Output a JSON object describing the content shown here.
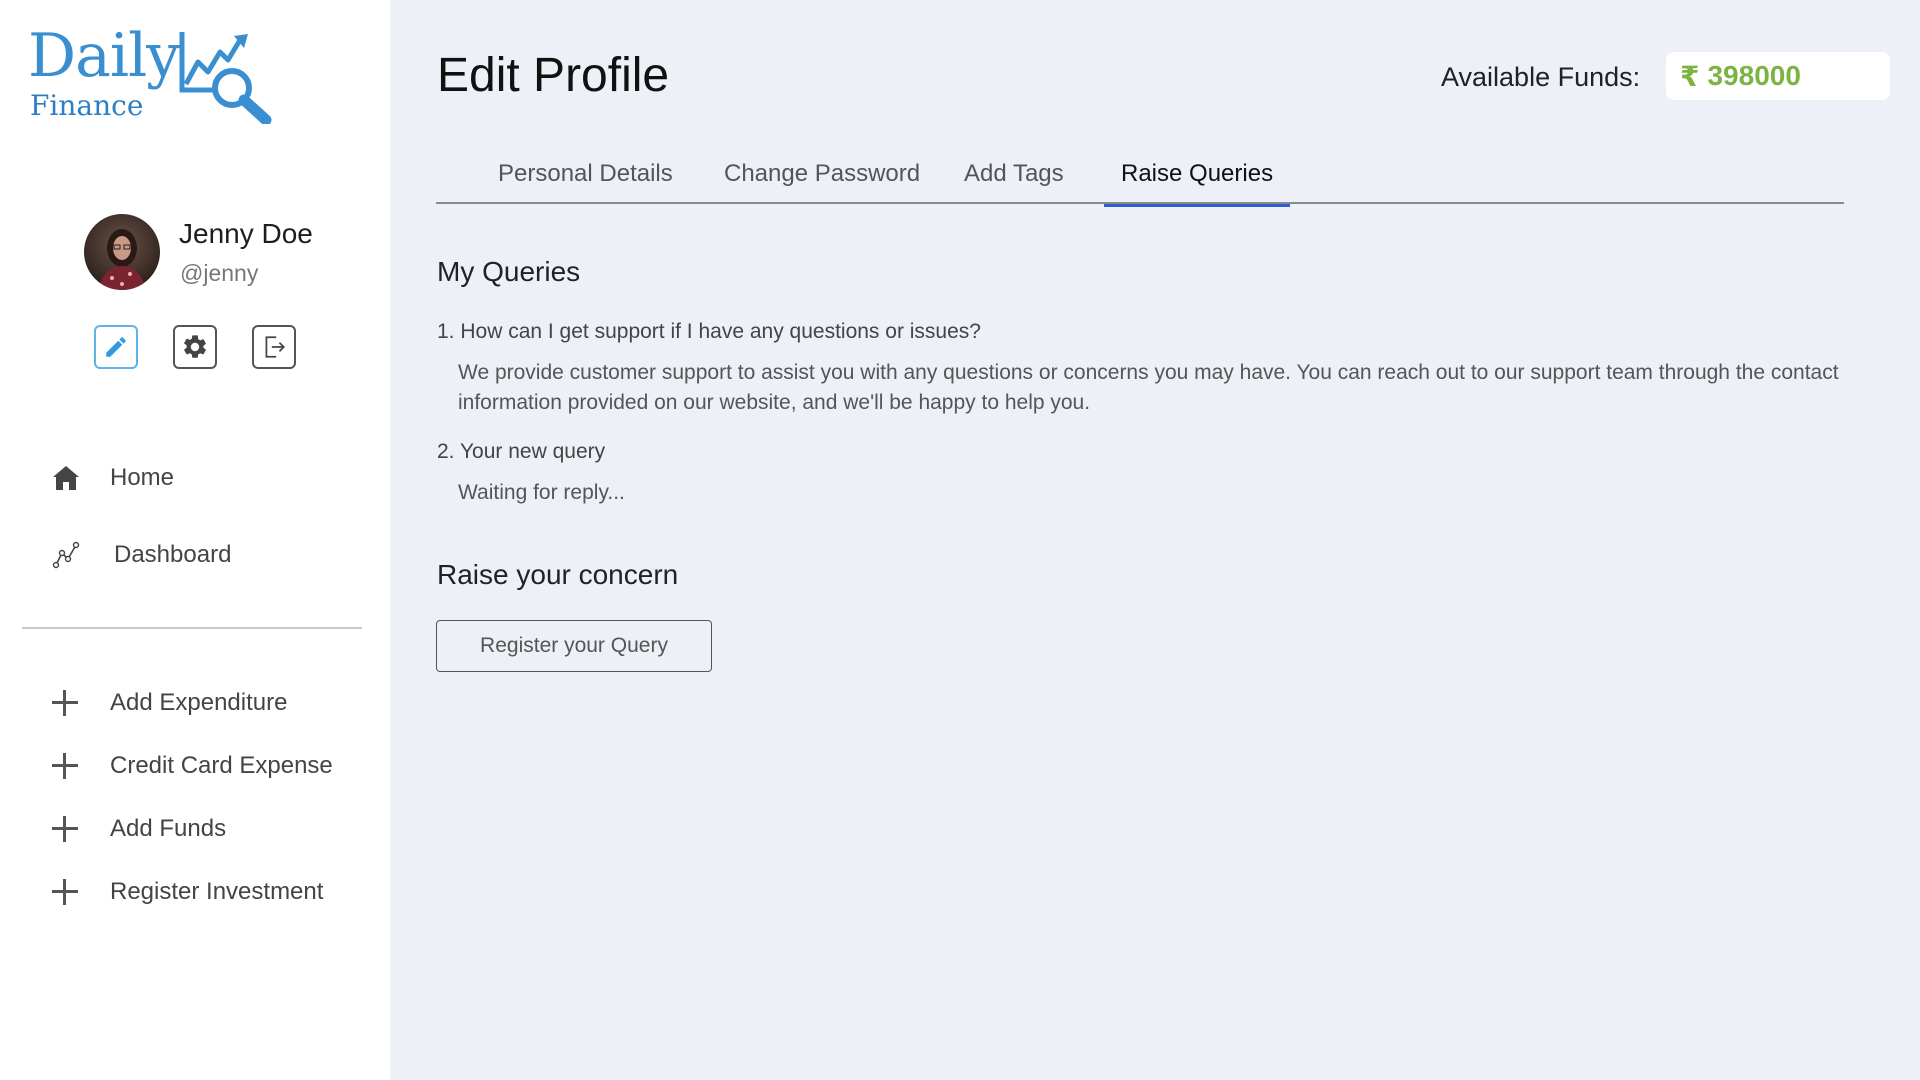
{
  "brand": {
    "name": "Daily",
    "sub": "Finance",
    "accent": "#3a8fd0"
  },
  "user": {
    "name": "Jenny Doe",
    "handle": "@jenny"
  },
  "profile_actions": [
    {
      "icon": "pencil-icon"
    },
    {
      "icon": "gear-icon"
    },
    {
      "icon": "logout-icon"
    }
  ],
  "nav": [
    {
      "label": "Home",
      "icon": "home-icon"
    },
    {
      "label": "Dashboard",
      "icon": "chart-icon"
    }
  ],
  "actions": [
    {
      "label": "Add Expenditure",
      "icon": "plus-icon"
    },
    {
      "label": "Credit Card Expense",
      "icon": "plus-icon"
    },
    {
      "label": "Add Funds",
      "icon": "plus-icon"
    },
    {
      "label": "Register Investment",
      "icon": "plus-icon"
    }
  ],
  "header": {
    "title": "Edit Profile",
    "funds_label": "Available Funds:",
    "funds_currency": "₹",
    "funds_value": "398000",
    "funds_color": "#7cb342"
  },
  "tabs": [
    {
      "label": "Personal Details"
    },
    {
      "label": "Change Password"
    },
    {
      "label": "Add Tags"
    },
    {
      "label": "Raise Queries",
      "active": true
    }
  ],
  "queries": {
    "title": "My Queries",
    "items": [
      {
        "question": "1. How can I get support if I have any questions or issues?",
        "answer": "We provide customer support to assist you with any questions or concerns you may have. You can reach out to our support team through the contact information provided on our website, and we'll be happy to help you."
      },
      {
        "question": "2. Your new query",
        "answer": "Waiting for reply..."
      }
    ]
  },
  "concern": {
    "title": "Raise your concern",
    "button_label": "Register your Query"
  }
}
